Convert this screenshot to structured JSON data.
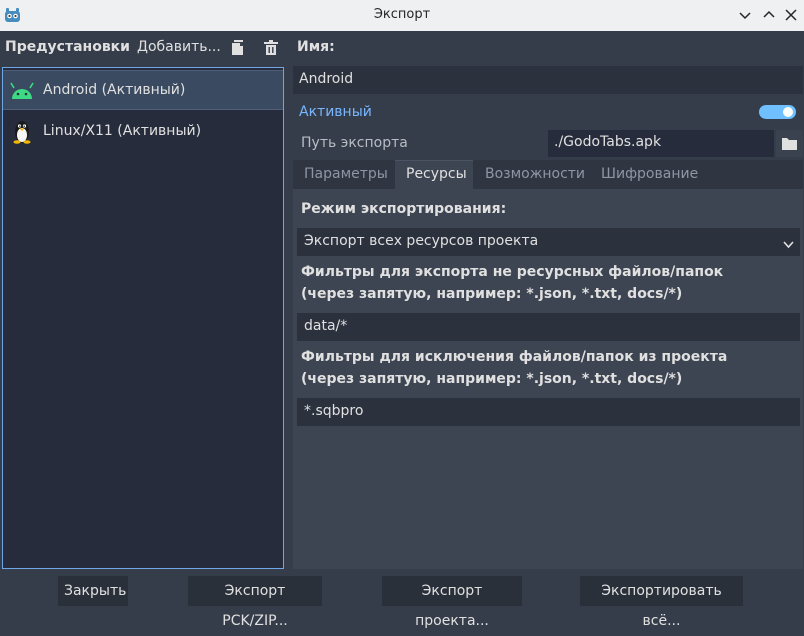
{
  "window": {
    "title": "Экспорт"
  },
  "presets": {
    "header_label": "Предустановки",
    "add_label": "Добавить...",
    "items": [
      {
        "label": "Android (Активный)",
        "icon": "android-icon"
      },
      {
        "label": "Linux/X11 (Активный)",
        "icon": "linux-icon"
      }
    ]
  },
  "details": {
    "name_label": "Имя:",
    "name_value": "Android",
    "active_label": "Активный",
    "active_on": true,
    "export_path_label": "Путь экспорта",
    "export_path_value": "./GodoTabs.apk"
  },
  "tabs": [
    {
      "label": "Параметры",
      "active": false
    },
    {
      "label": "Ресурсы",
      "active": true
    },
    {
      "label": "Возможности",
      "active": false
    },
    {
      "label": "Шифрование",
      "active": false
    }
  ],
  "resources": {
    "mode_label": "Режим экспортирования:",
    "mode_value": "Экспорт всех ресурсов проекта",
    "include_filter_label_line1": "Фильтры для экспорта не ресурсных файлов/папок",
    "include_filter_label_line2": "(через запятую, например: *.json, *.txt, docs/*)",
    "include_filter_value": "data/*",
    "exclude_filter_label_line1": "Фильтры для исключения файлов/папок из проекта",
    "exclude_filter_label_line2": "(через запятую, например: *.json, *.txt, docs/*)",
    "exclude_filter_value": "*.sqbpro"
  },
  "footer": {
    "close_label": "Закрыть",
    "export_pck_label": "Экспорт PCK/ZIP...",
    "export_project_label": "Экспорт проекта...",
    "export_all_label": "Экспортировать всё..."
  },
  "colors": {
    "accent": "#6fa7e6",
    "active_text": "#78b7ff",
    "toggle_on": "#70bfff",
    "android_green": "#3ddc84"
  }
}
